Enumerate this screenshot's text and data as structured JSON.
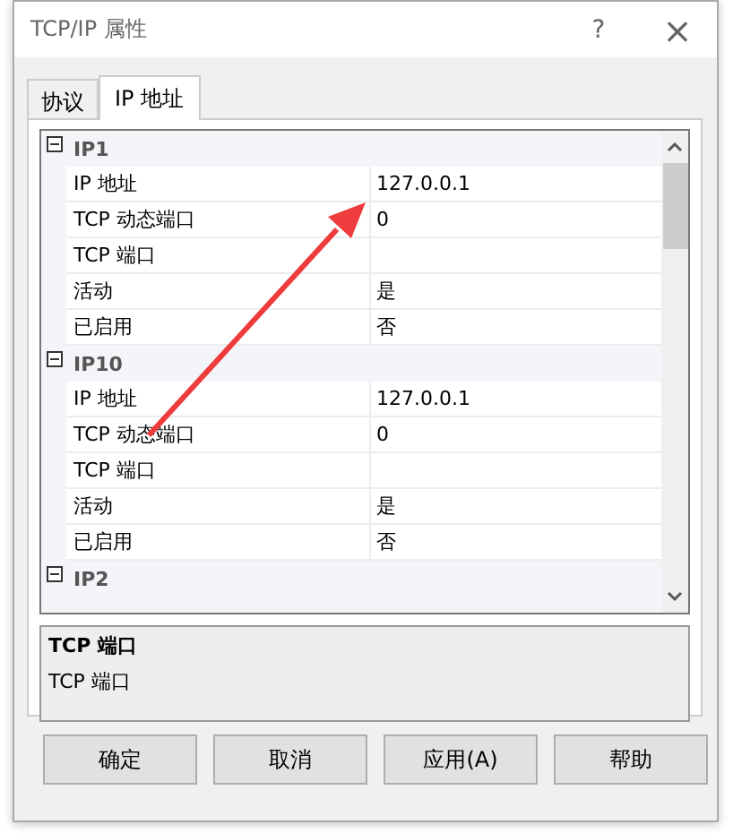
{
  "window": {
    "title": "TCP/IP 属性",
    "help": "?",
    "close": "×"
  },
  "tabs": [
    {
      "label": "协议",
      "selected": false
    },
    {
      "label": "IP 地址",
      "selected": true
    }
  ],
  "groups": [
    {
      "name": "IP1",
      "expanded": true,
      "properties": [
        {
          "name": "IP 地址",
          "value": "127.0.0.1"
        },
        {
          "name": "TCP 动态端口",
          "value": "0"
        },
        {
          "name": "TCP 端口"
        },
        {
          "name": "活动",
          "value": "是"
        },
        {
          "name": "已启用",
          "value": "否"
        }
      ]
    },
    {
      "name": "IP10",
      "expanded": true,
      "properties": [
        {
          "name": "IP 地址",
          "value": "127.0.0.1"
        },
        {
          "name": "TCP 动态端口",
          "value": "0"
        },
        {
          "name": "TCP 端口"
        },
        {
          "name": "活动",
          "value": "是"
        },
        {
          "name": "已启用",
          "value": "否"
        }
      ]
    },
    {
      "name": "IP2",
      "expanded": true
    }
  ],
  "description": {
    "title": "TCP 端口",
    "text": "TCP 端口"
  },
  "buttons": [
    "确定",
    "取消",
    "应用(A)",
    "帮助"
  ],
  "annotation": {
    "kind": "arrow",
    "color": "#ee3b3b"
  }
}
